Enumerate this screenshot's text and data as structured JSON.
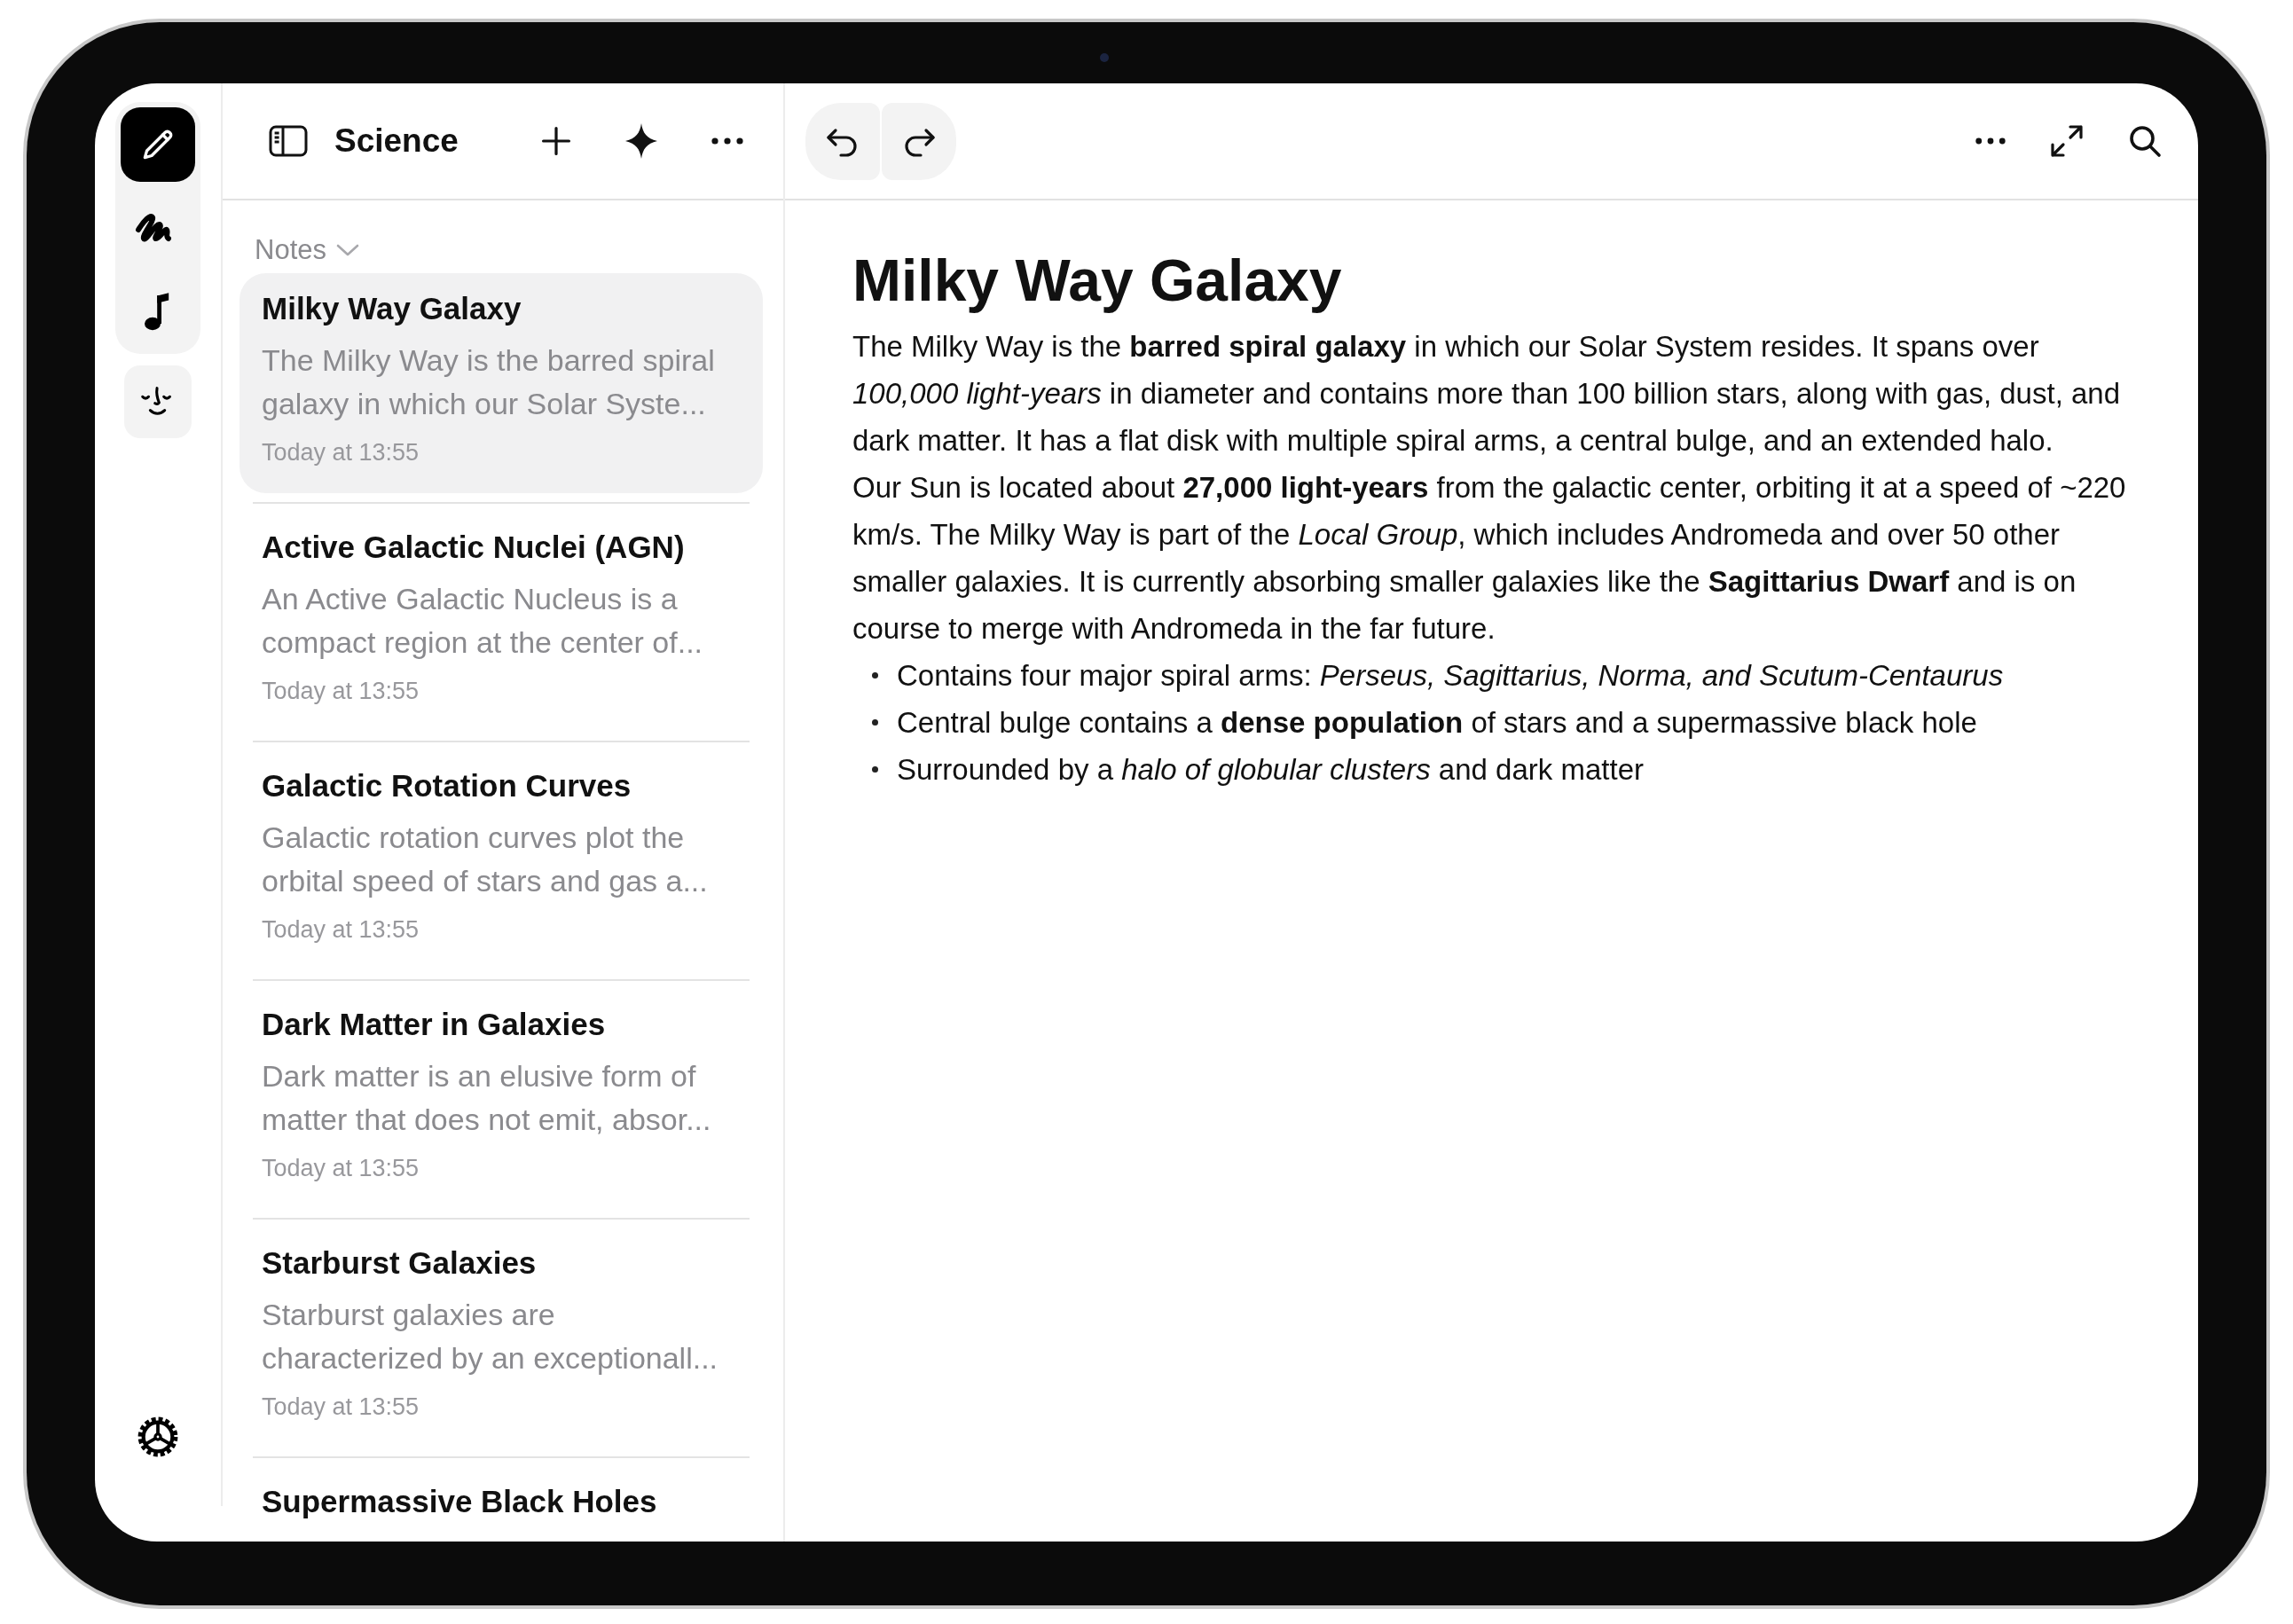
{
  "rail": {
    "tools": [
      {
        "selected": true
      },
      {
        "selected": false
      },
      {
        "selected": false
      }
    ]
  },
  "sidebar": {
    "folder_title": "Science",
    "section_label": "Notes",
    "notes": [
      {
        "title": "Milky Way Galaxy",
        "preview": "The Milky Way is the barred spiral galaxy in which our Solar Syste...",
        "date": "Today at 13:55",
        "selected": true
      },
      {
        "title": "Active Galactic Nuclei (AGN)",
        "preview": "An Active Galactic Nucleus is a compact region at the center of...",
        "date": "Today at 13:55",
        "selected": false
      },
      {
        "title": "Galactic Rotation Curves",
        "preview": "Galactic rotation curves plot the orbital speed of stars and gas a...",
        "date": "Today at 13:55",
        "selected": false
      },
      {
        "title": "Dark Matter in Galaxies",
        "preview": "Dark matter is an elusive form of matter that does not emit, absor...",
        "date": "Today at 13:55",
        "selected": false
      },
      {
        "title": "Starburst Galaxies",
        "preview": "Starburst galaxies are characterized by an exceptionall...",
        "date": "Today at 13:55",
        "selected": false
      },
      {
        "title": "Supermassive Black Holes",
        "selected": false
      }
    ]
  },
  "editor": {
    "title": "Milky Way Galaxy",
    "paragraphs": [
      "The Milky Way is the **barred spiral galaxy** in which our Solar System resides. It spans over *100,000 light-years* in diameter and contains more than 100 billion stars, along with gas, dust, and dark matter. It has a flat disk with multiple spiral arms, a central bulge, and an extended halo.",
      "Our Sun is located about **27,000 light-years** from the galactic center, orbiting it at a speed of ~220 km/s. The Milky Way is part of the *Local Group*, which includes Andromeda and over 50 other smaller galaxies. It is currently absorbing smaller galaxies like the **Sagittarius Dwarf** and is on course to merge with Andromeda in the far future."
    ],
    "bullets": [
      "Contains four major spiral arms: *Perseus, Sagittarius, Norma, and Scutum-Centaurus*",
      "Central bulge contains a **dense population** of stars and a supermassive black hole",
      "Surrounded by a *halo of globular clusters* and dark matter"
    ]
  }
}
